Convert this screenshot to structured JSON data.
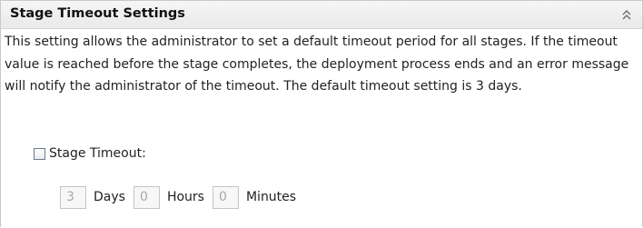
{
  "panel": {
    "title": "Stage Timeout Settings",
    "collapse_icon": "double-chevron-up-icon",
    "description": "This setting allows the administrator to set a default timeout period for all stages. If the timeout value is reached before the stage completes, the deployment process ends and an error message will notify the administrator of the timeout. The default timeout setting is 3 days."
  },
  "stage_timeout": {
    "label": "Stage Timeout:",
    "checked": false,
    "days": {
      "value": "3",
      "label": "Days"
    },
    "hours": {
      "value": "0",
      "label": "Hours"
    },
    "minutes": {
      "value": "0",
      "label": "Minutes"
    }
  },
  "colors": {
    "header_bg": "#eeeeee",
    "border": "#c9c9c9",
    "disabled_text": "#a8a8a8"
  }
}
